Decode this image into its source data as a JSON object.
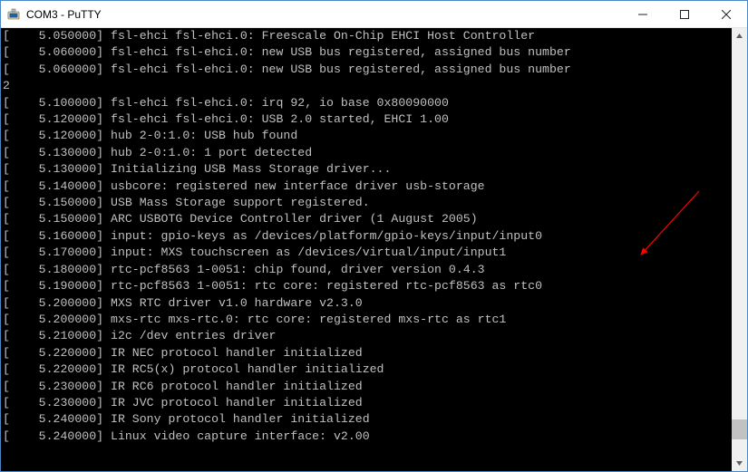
{
  "window": {
    "title": "COM3 - PuTTY"
  },
  "terminal": {
    "lines": [
      "[    5.050000] fsl-ehci fsl-ehci.0: Freescale On-Chip EHCI Host Controller",
      "[    5.060000] fsl-ehci fsl-ehci.0: new USB bus registered, assigned bus number 2",
      "[    5.100000] fsl-ehci fsl-ehci.0: irq 92, io base 0x80090000",
      "[    5.120000] fsl-ehci fsl-ehci.0: USB 2.0 started, EHCI 1.00",
      "[    5.120000] hub 2-0:1.0: USB hub found",
      "[    5.130000] hub 2-0:1.0: 1 port detected",
      "[    5.130000] Initializing USB Mass Storage driver...",
      "[    5.140000] usbcore: registered new interface driver usb-storage",
      "[    5.150000] USB Mass Storage support registered.",
      "[    5.150000] ARC USBOTG Device Controller driver (1 August 2005)",
      "[    5.160000] input: gpio-keys as /devices/platform/gpio-keys/input/input0",
      "[    5.170000] input: MXS touchscreen as /devices/virtual/input/input1",
      "[    5.180000] rtc-pcf8563 1-0051: chip found, driver version 0.4.3",
      "[    5.190000] rtc-pcf8563 1-0051: rtc core: registered rtc-pcf8563 as rtc0",
      "[    5.200000] MXS RTC driver v1.0 hardware v2.3.0",
      "[    5.200000] mxs-rtc mxs-rtc.0: rtc core: registered mxs-rtc as rtc1",
      "[    5.210000] i2c /dev entries driver",
      "[    5.220000] IR NEC protocol handler initialized",
      "[    5.220000] IR RC5(x) protocol handler initialized",
      "[    5.230000] IR RC6 protocol handler initialized",
      "[    5.230000] IR JVC protocol handler initialized",
      "[    5.240000] IR Sony protocol handler initialized",
      "[    5.240000] Linux video capture interface: v2.00"
    ]
  },
  "icons": {
    "app": "putty-icon",
    "minimize": "minimize-icon",
    "maximize": "maximize-icon",
    "close": "close-icon",
    "scroll_up": "scroll-up-icon",
    "scroll_down": "scroll-down-icon"
  }
}
